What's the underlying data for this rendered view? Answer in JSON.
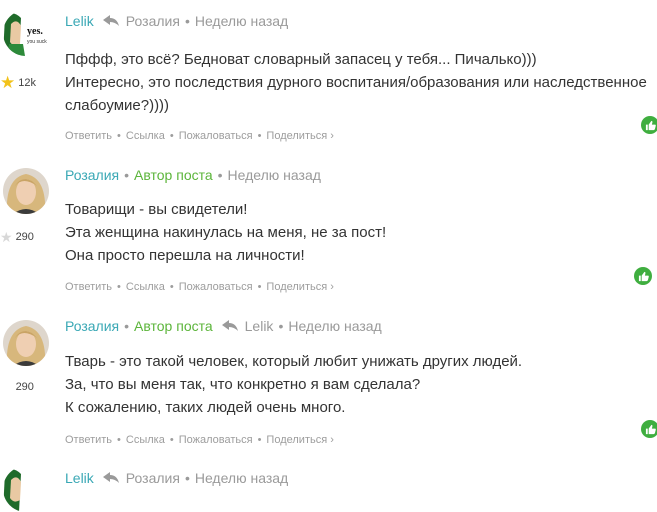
{
  "comments": [
    {
      "author": "Lelik",
      "badge": "",
      "reply_to": "Розалия",
      "time": "Неделю назад",
      "karma": "12k",
      "lines": [
        "Пффф, это всё? Бедноват словарный запасец у тебя... Пичалько)))",
        "Интересно, это последствия дурного воспитания/образования или наследственное",
        "слабоумие?))))"
      ],
      "actions": {
        "reply": "Ответить",
        "link": "Ссылка",
        "report": "Пожаловаться",
        "share": "Поделиться ›"
      }
    },
    {
      "author": "Розалия",
      "badge": "Автор поста",
      "reply_to": "",
      "time": "Неделю назад",
      "karma": "290",
      "lines": [
        "Товарищи - вы свидетели!",
        "Эта женщина накинулась на меня, не за пост!",
        "Она просто перешла на личности!"
      ],
      "actions": {
        "reply": "Ответить",
        "link": "Ссылка",
        "report": "Пожаловаться",
        "share": "Поделиться ›"
      }
    },
    {
      "author": "Розалия",
      "badge": "Автор поста",
      "reply_to": "Lelik",
      "time": "Неделю назад",
      "karma": "290",
      "lines": [
        "Тварь - это такой человек, который любит унижать других людей.",
        "За, что вы меня так, что конкретно я вам сделала?",
        "К сожалению, таких людей очень много."
      ],
      "actions": {
        "reply": "Ответить",
        "link": "Ссылка",
        "report": "Пожаловаться",
        "share": "Поделиться ›"
      }
    },
    {
      "author": "Lelik",
      "badge": "",
      "reply_to": "Розалия",
      "time": "Неделю назад",
      "karma": "",
      "lines": [],
      "actions": {}
    }
  ],
  "avatar_lelik_text": [
    "yes.",
    "you suck."
  ],
  "colors": {
    "author": "#3aa8b5",
    "badge": "#5cb53b",
    "meta": "#9a9a9a",
    "like_button": "#3fae3f"
  },
  "icons": {
    "reply": "reply-arrow-icon",
    "like": "thumbs-up-icon",
    "karma": "star-icon"
  }
}
